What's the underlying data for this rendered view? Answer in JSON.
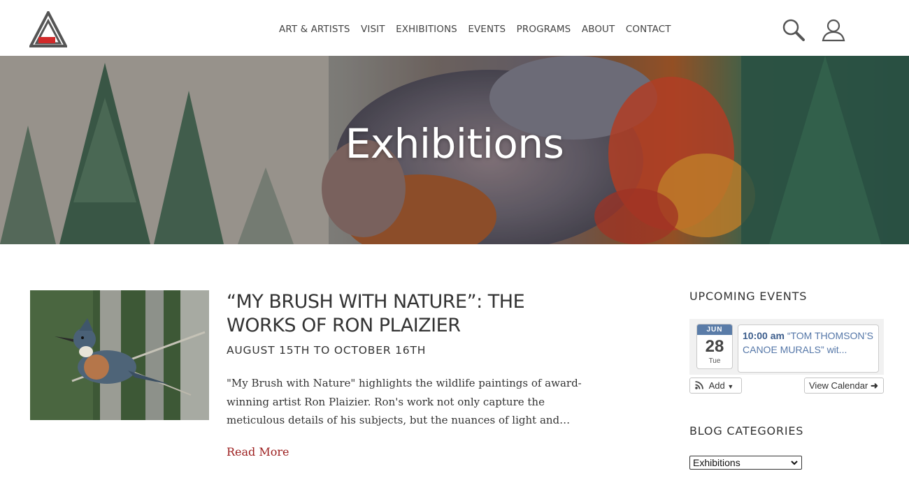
{
  "header": {
    "nav": [
      "ART & ARTISTS",
      "VISIT",
      "EXHIBITIONS",
      "EVENTS",
      "PROGRAMS",
      "ABOUT",
      "CONTACT"
    ]
  },
  "hero": {
    "title": "Exhibitions"
  },
  "article": {
    "title": "“MY BRUSH WITH NATURE”: THE WORKS OF RON PLAIZIER",
    "dates": "AUGUST 15TH TO OCTOBER 16TH",
    "excerpt": "\"My Brush with Nature\" highlights the wildlife paintings of award-winning artist Ron Plaizier. Ron's work not only capture the meticulous details of his subjects, but the nuances of light and…",
    "read_more": "Read More"
  },
  "sidebar": {
    "upcoming_heading": "UPCOMING EVENTS",
    "event": {
      "month": "JUN",
      "day": "28",
      "dow": "Tue",
      "time": "10:00 am",
      "title": "“TOM THOMSON’S CANOE MURALS” wit..."
    },
    "add_label": "Add",
    "view_calendar_label": "View Calendar",
    "categories_heading": "BLOG CATEGORIES",
    "category_selected": "Exhibitions"
  },
  "colors": {
    "accent_red": "#9b1c1c",
    "logo_grey": "#555555",
    "logo_red": "#d12a2a",
    "calendar_blue": "#5a7ca8"
  }
}
